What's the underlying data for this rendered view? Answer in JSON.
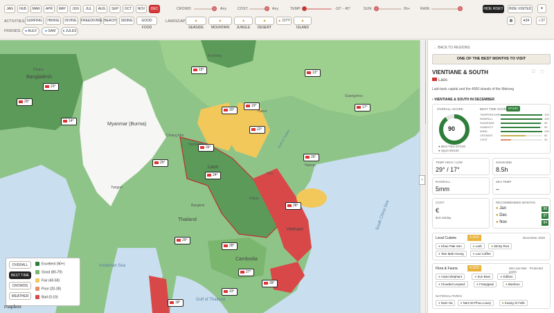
{
  "months": [
    "JAN",
    "FEB",
    "MAR",
    "APR",
    "MAY",
    "JUN",
    "JUL",
    "AUG",
    "SEP",
    "OCT",
    "NOV",
    "DEC"
  ],
  "selected_month": "DEC",
  "filters": {
    "crowds": {
      "label": "CROWD:",
      "value": "Any"
    },
    "cost": {
      "label": "COST:",
      "value": "Any"
    },
    "temp": {
      "label": "TEMP:",
      "value": "-10° - 45°"
    },
    "sun": {
      "label": "SUN:",
      "value": "0h+"
    },
    "rain": {
      "label": "RAIN:",
      "value": ""
    }
  },
  "hide_risky": "HIDE RISKY",
  "hide_visited": "HIDE VISITED",
  "activities_label": "ACTIVITIES:",
  "activities": [
    "SURFING",
    "HIKING",
    "DIVING",
    "FREEDIVING",
    "BEACH",
    "SKIING",
    "GOOD FOOD"
  ],
  "landscape_label": "LANDSCAPE:",
  "landscapes": [
    "SEASIDE",
    "MOUNTAIN",
    "JUNGLE",
    "DESERT",
    "CITY",
    "ISLAND"
  ],
  "friends_label": "FRIENDS:",
  "friends": [
    "ALEX",
    "SAM",
    "JULES"
  ],
  "counters": {
    "a": "34",
    "b": "27"
  },
  "map": {
    "countries": [
      "Bangladesh",
      "Myanmar (Burma)",
      "Thailand",
      "Cambodia",
      "Vietnam",
      "Laos"
    ],
    "places": [
      "Dhaka",
      "Kunming",
      "Guangzhou",
      "Hanoi",
      "Bangkok",
      "Yangon",
      "Hainan",
      "Chiang Mai",
      "Hue",
      "Pakse",
      "Vientiane"
    ],
    "seas": [
      "Andaman Sea",
      "Gulf of Thailand",
      "South China Sea",
      "Gulf of Tonkin"
    ],
    "markers": [
      "23°",
      "25°",
      "13°",
      "15°",
      "17°",
      "19°",
      "14°",
      "20°",
      "22°",
      "26°",
      "25°",
      "24°",
      "26°",
      "28°",
      "29°",
      "28°",
      "27°",
      "28°",
      "23°",
      "18°"
    ],
    "attribution": "mapbox"
  },
  "legend": [
    {
      "label": "Excellent (90+)",
      "color": "#2e7d3a"
    },
    {
      "label": "Good (80-79)",
      "color": "#7bb66f"
    },
    {
      "label": "Fair (40-59)",
      "color": "#f2c85b"
    },
    {
      "label": "Poor (20-39)",
      "color": "#e58e6a"
    },
    {
      "label": "Bad (0-19)",
      "color": "#d94848"
    }
  ],
  "view_buttons": [
    "OVERALL",
    "BEST TIME",
    "CROWDS",
    "WEATHER"
  ],
  "active_view": "BEST TIME",
  "panel": {
    "back": "BACK TO REGIONS",
    "banner": "ONE OF THE BEST MONTHS TO VISIT",
    "title": "VIENTIANE & SOUTH",
    "country": "Laos",
    "desc": "Laid-back capital and the 4000 islands of the Mekong",
    "section": "VIENTIANE & SOUTH IN DECEMBER",
    "overall_label": "OVERALL SCORE",
    "score": "90",
    "best_time_label": "BEST TIME SCORE",
    "best_time_value": "87/100",
    "metrics": [
      {
        "name": "TEMPERATURE",
        "value": "100"
      },
      {
        "name": "RAINFALL",
        "value": "100"
      },
      {
        "name": "SUNSHINE",
        "value": "96"
      },
      {
        "name": "HUMIDITY",
        "value": "95"
      },
      {
        "name": "WIND",
        "value": "100"
      },
      {
        "name": "CROWDS",
        "value": "60"
      },
      {
        "name": "COST",
        "value": "25"
      }
    ],
    "legend_left": "Best Time",
    "legend_left_val": "87/100",
    "legend_right": "Sport",
    "legend_right_val": "90/100",
    "temp_label": "TEMP HIGH / LOW",
    "temp_value": "29° / 17°",
    "sun_label": "SUNSHINE",
    "sun_value": "8.5h",
    "rain_label": "RAINFALL",
    "rain_value": "5mm",
    "sea_label": "SEA TEMP",
    "sea_value": "–",
    "cost_label": "COST",
    "cost_value": "€",
    "cost_sub": "$15-25/day",
    "rec_label": "RECOMMENDED MONTHS",
    "rec": [
      {
        "month": "Jan",
        "score": "88"
      },
      {
        "month": "Dec",
        "score": "87"
      },
      {
        "month": "Nov",
        "score": "84"
      }
    ],
    "cuisine_label": "Local Cuisine",
    "cuisine_score": "4.3/10",
    "cuisine_extra": "December 2025",
    "dishes": [
      "Khao Piak Sen",
      "Larb",
      "Sticky Rice",
      "Tam Mak Hoong",
      "Lao Coffee"
    ],
    "flora_label": "Flora & Fauna",
    "flora_score": "4.3/10",
    "flora_extra": "Wet Jan-Mar · Protected parks",
    "flora": [
      "Asian Elephant",
      "Sun Bear",
      "Gibbon",
      "Clouded Leopard",
      "Frangipani",
      "Bamboo"
    ],
    "parks_label": "NATIONAL PARKS",
    "parks": [
      "Nam Ha",
      "Nam Et-Phou Louey",
      "Kuang Si Falls"
    ]
  }
}
